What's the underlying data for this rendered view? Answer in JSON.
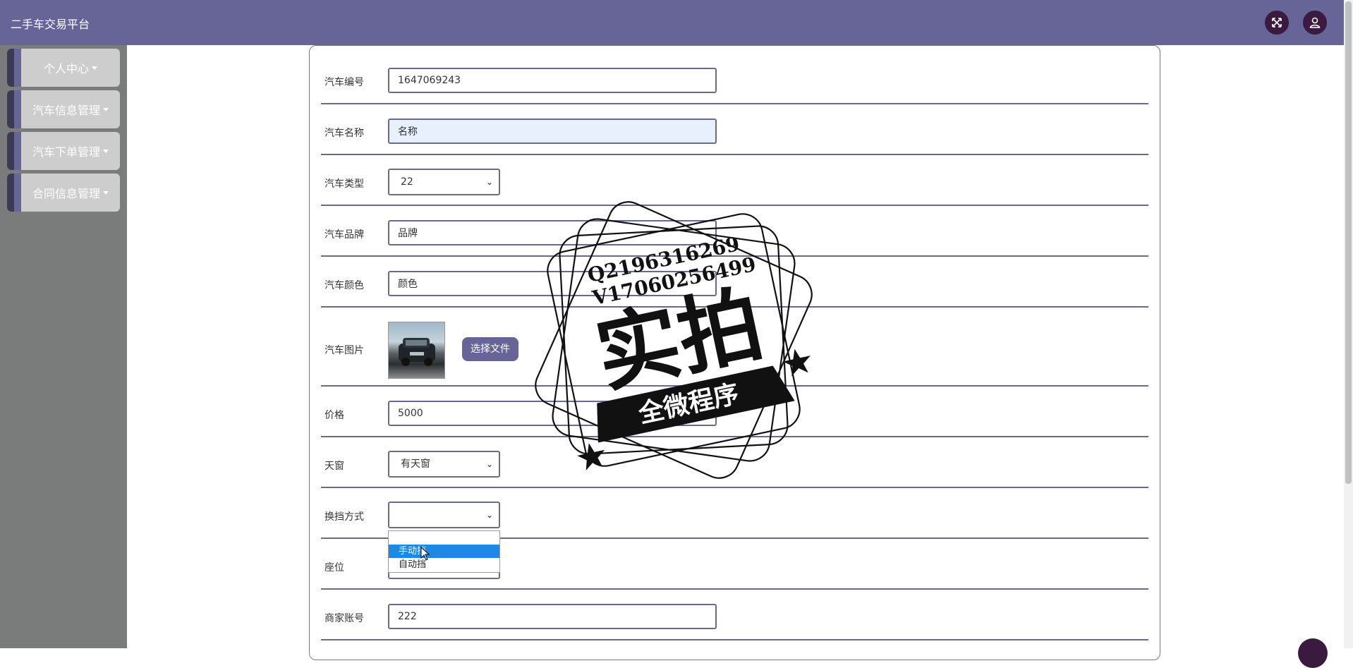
{
  "app": {
    "title": "二手车交易平台"
  },
  "header": {
    "fullscreen_icon": "expand-arrows-icon",
    "user_icon": "user-icon"
  },
  "sidebar": {
    "items": [
      {
        "label": "个人中心"
      },
      {
        "label": "汽车信息管理"
      },
      {
        "label": "汽车下单管理"
      },
      {
        "label": "合同信息管理"
      }
    ]
  },
  "form": {
    "car_no": {
      "label": "汽车编号",
      "value": "1647069243"
    },
    "car_name": {
      "label": "汽车名称",
      "value": "名称"
    },
    "car_type": {
      "label": "汽车类型",
      "value": "22"
    },
    "brand": {
      "label": "汽车品牌",
      "value": "品牌"
    },
    "color": {
      "label": "汽车颜色",
      "value": "颜色"
    },
    "image": {
      "label": "汽车图片",
      "button": "选择文件"
    },
    "price": {
      "label": "价格",
      "value": "5000"
    },
    "sunroof": {
      "label": "天窗",
      "value": "有天窗"
    },
    "gearbox": {
      "label": "换挡方式",
      "value": "",
      "options": [
        "",
        "手动挡",
        "自动挡"
      ],
      "highlighted": "手动挡"
    },
    "seats": {
      "label": "座位",
      "value": ""
    },
    "merchant": {
      "label": "商家账号",
      "value": "222"
    }
  },
  "watermark": {
    "line1": "Q2196316269",
    "line2": "V17060256499",
    "main": "实拍",
    "banner": "全微程序"
  },
  "colors": {
    "header_bg": "#676497",
    "sidebar_bg": "#7a7c7b",
    "accent": "#676497",
    "dark": "#3a1a3f",
    "option_highlight": "#1e88e5"
  }
}
